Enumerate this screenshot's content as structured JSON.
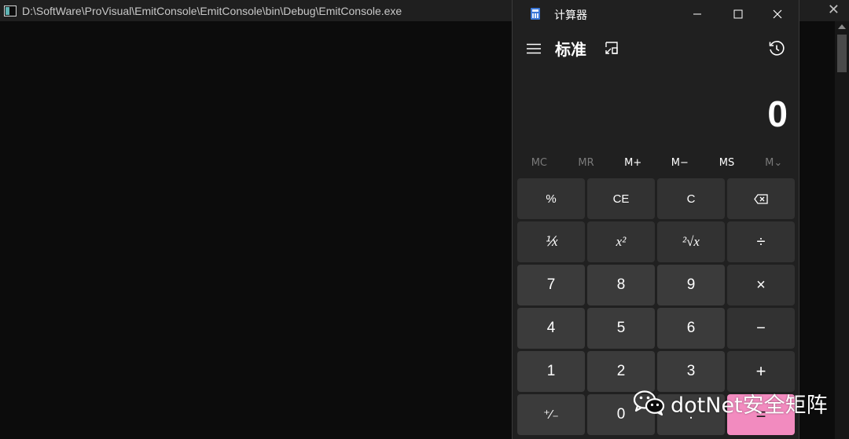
{
  "console": {
    "title": "D:\\SoftWare\\ProVisual\\EmitConsole\\EmitConsole\\bin\\Debug\\EmitConsole.exe",
    "close_label": "✕"
  },
  "calculator": {
    "title": "计算器",
    "mode": "标准",
    "display_value": "0",
    "memory": [
      {
        "label": "MC",
        "enabled": false
      },
      {
        "label": "MR",
        "enabled": false
      },
      {
        "label": "M+",
        "enabled": true
      },
      {
        "label": "M−",
        "enabled": true
      },
      {
        "label": "MS",
        "enabled": true
      },
      {
        "label": "M⌄",
        "enabled": false
      }
    ],
    "keys": {
      "percent": "%",
      "ce": "CE",
      "c": "C",
      "reciprocal": "⅟x",
      "square": "x²",
      "sqrt": "²√x",
      "divide": "÷",
      "seven": "7",
      "eight": "8",
      "nine": "9",
      "multiply": "×",
      "four": "4",
      "five": "5",
      "six": "6",
      "minus": "−",
      "one": "1",
      "two": "2",
      "three": "3",
      "plus": "+",
      "negate": "⁺∕₋",
      "zero": "0",
      "decimal": ".",
      "equals": "="
    },
    "colors": {
      "accent": "#f28bbf",
      "background": "#202020",
      "function_key": "#323232",
      "number_key": "#3b3b3b"
    }
  },
  "watermark": {
    "text": "dotNet安全矩阵"
  }
}
